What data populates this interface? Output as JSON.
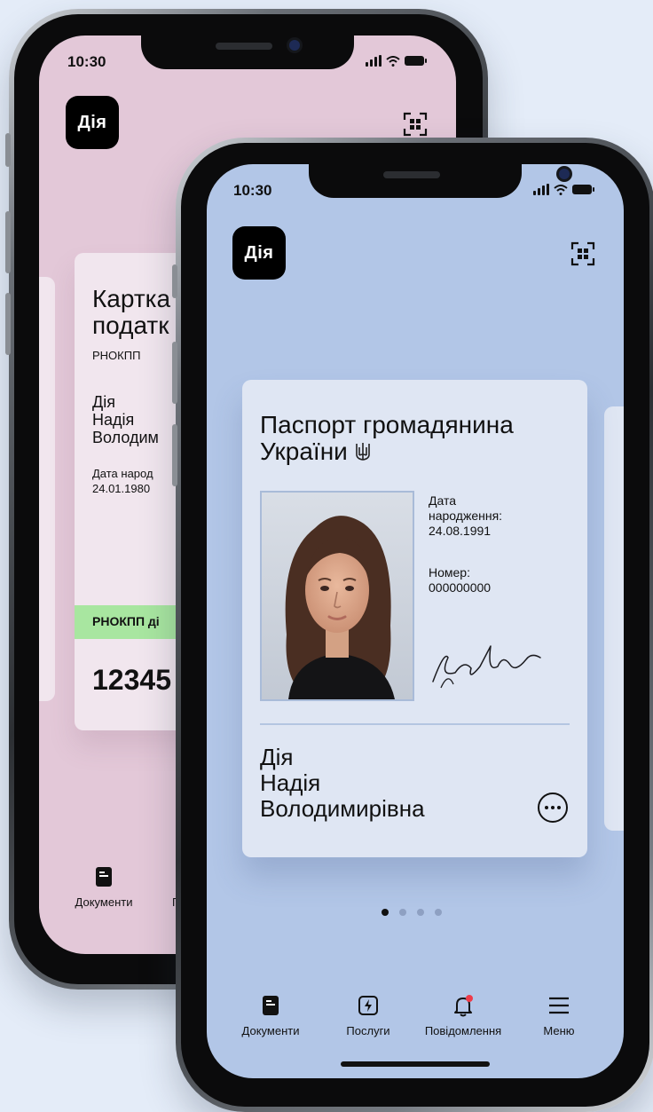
{
  "back_phone": {
    "time": "10:30",
    "logo": "Дія",
    "card": {
      "title_line1": "Картка",
      "title_line2": "податк",
      "subtitle": "РНОКПП",
      "name_line1": "Дія",
      "name_line2": "Надія",
      "name_line3": "Володим",
      "dob_label": "Дата народ",
      "dob_value": "24.01.1980",
      "badge": "РНОКПП ді",
      "number": "12345"
    },
    "tab_documents": "Документи",
    "tab_partial": "П"
  },
  "front_phone": {
    "time": "10:30",
    "logo": "Дія",
    "card": {
      "title_line1": "Паспорт громадянина",
      "title_line2": "України",
      "dob_label_1": "Дата",
      "dob_label_2": "народження:",
      "dob_value": "24.08.1991",
      "number_label": "Номер:",
      "number_value": "000000000",
      "surname": "Дія",
      "given_name": "Надія",
      "patronymic": "Володимирівна"
    },
    "tabs": [
      {
        "label": "Документи",
        "icon": "document-icon"
      },
      {
        "label": "Послуги",
        "icon": "lightning-icon"
      },
      {
        "label": "Повідомлення",
        "icon": "bell-icon"
      },
      {
        "label": "Меню",
        "icon": "menu-icon"
      }
    ],
    "pager": {
      "count": 4,
      "active": 1
    }
  },
  "colors": {
    "background": "#e4ecf8",
    "back_screen": "#e3c8d8",
    "back_card": "#f1e6ee",
    "back_badge": "#a8e6a0",
    "front_screen": "#b2c6e7",
    "front_card": "#dfe6f3",
    "notification_dot": "#ef3b4a"
  }
}
